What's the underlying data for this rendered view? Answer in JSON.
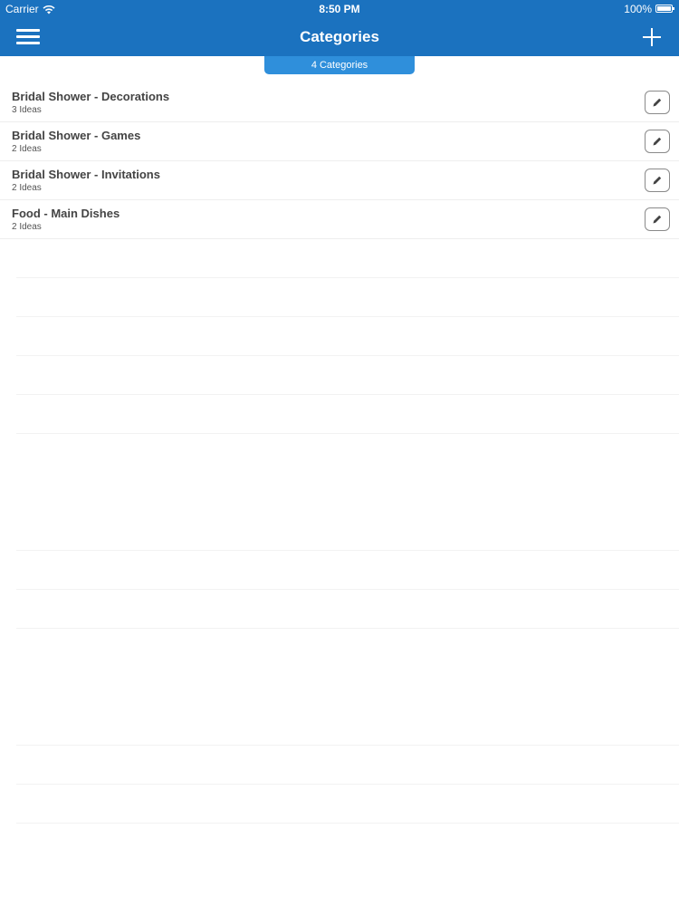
{
  "status_bar": {
    "carrier": "Carrier",
    "time": "8:50 PM",
    "battery": "100%"
  },
  "nav": {
    "title": "Categories",
    "menu_icon": "hamburger-menu-icon",
    "add_icon": "plus-icon"
  },
  "badge": {
    "text": "4 Categories"
  },
  "categories": [
    {
      "title": "Bridal Shower - Decorations",
      "count": "3 Ideas"
    },
    {
      "title": "Bridal Shower - Games",
      "count": "2 Ideas"
    },
    {
      "title": "Bridal Shower - Invitations",
      "count": "2 Ideas"
    },
    {
      "title": "Food - Main Dishes",
      "count": "2 Ideas"
    }
  ],
  "colors": {
    "header": "#1b72bf",
    "badge": "#2f8fdb"
  }
}
